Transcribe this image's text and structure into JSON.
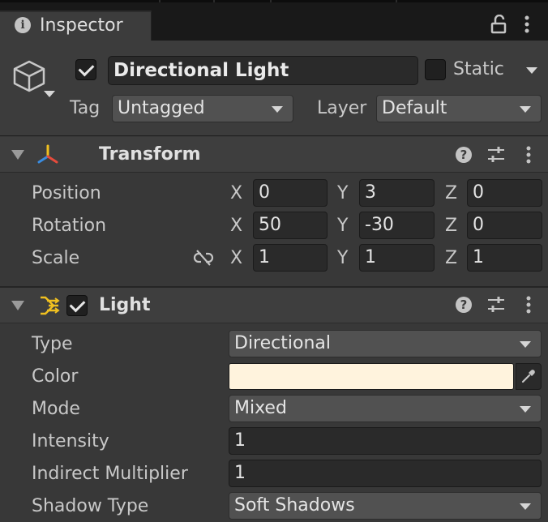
{
  "tab": {
    "title": "Inspector",
    "icon": "info-icon"
  },
  "gameobject": {
    "active": true,
    "name": "Directional Light",
    "static_label": "Static",
    "static_checked": false,
    "tag_label": "Tag",
    "tag_value": "Untagged",
    "layer_label": "Layer",
    "layer_value": "Default"
  },
  "transform": {
    "title": "Transform",
    "rows": [
      {
        "label": "Position",
        "x": "0",
        "y": "3",
        "z": "0"
      },
      {
        "label": "Rotation",
        "x": "50",
        "y": "-30",
        "z": "0"
      },
      {
        "label": "Scale",
        "x": "1",
        "y": "1",
        "z": "1"
      }
    ],
    "axis_x": "X",
    "axis_y": "Y",
    "axis_z": "Z"
  },
  "light": {
    "title": "Light",
    "enabled": true,
    "type_label": "Type",
    "type_value": "Directional",
    "color_label": "Color",
    "color_value": "#fff3dd",
    "mode_label": "Mode",
    "mode_value": "Mixed",
    "intensity_label": "Intensity",
    "intensity_value": "1",
    "indirect_label": "Indirect Multiplier",
    "indirect_value": "1",
    "shadow_label": "Shadow Type",
    "shadow_value": "Soft Shadows"
  }
}
